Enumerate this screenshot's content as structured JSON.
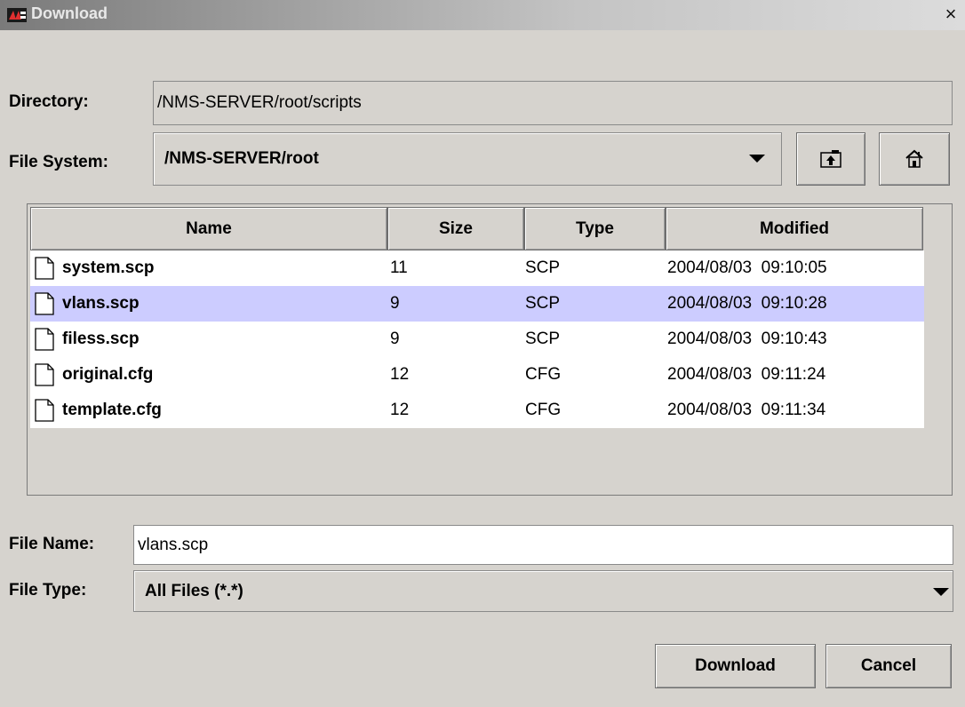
{
  "window": {
    "title": "Download",
    "close_glyph": "×"
  },
  "directory": {
    "label": "Directory:",
    "value": "/NMS-SERVER/root/scripts"
  },
  "file_system": {
    "label": "File System:",
    "selected": "/NMS-SERVER/root",
    "up_icon": "up-folder-icon",
    "home_icon": "home-icon"
  },
  "table": {
    "columns": [
      "Name",
      "Size",
      "Type",
      "Modified"
    ],
    "rows": [
      {
        "name": "system.scp",
        "size": "11",
        "type": "SCP",
        "modified": "2004/08/03  09:10:05",
        "selected": false
      },
      {
        "name": "vlans.scp",
        "size": "9",
        "type": "SCP",
        "modified": "2004/08/03  09:10:28",
        "selected": true
      },
      {
        "name": "filess.scp",
        "size": "9",
        "type": "SCP",
        "modified": "2004/08/03  09:10:43",
        "selected": false
      },
      {
        "name": "original.cfg",
        "size": "12",
        "type": "CFG",
        "modified": "2004/08/03  09:11:24",
        "selected": false
      },
      {
        "name": "template.cfg",
        "size": "12",
        "type": "CFG",
        "modified": "2004/08/03  09:11:34",
        "selected": false
      }
    ]
  },
  "file_name": {
    "label": "File Name:",
    "value": "vlans.scp"
  },
  "file_type": {
    "label": "File Type:",
    "selected": "All Files (*.*)"
  },
  "buttons": {
    "download": "Download",
    "cancel": "Cancel"
  },
  "colors": {
    "background": "#d6d3ce",
    "selection": "#ccccff",
    "list_bg": "#ffffff"
  }
}
